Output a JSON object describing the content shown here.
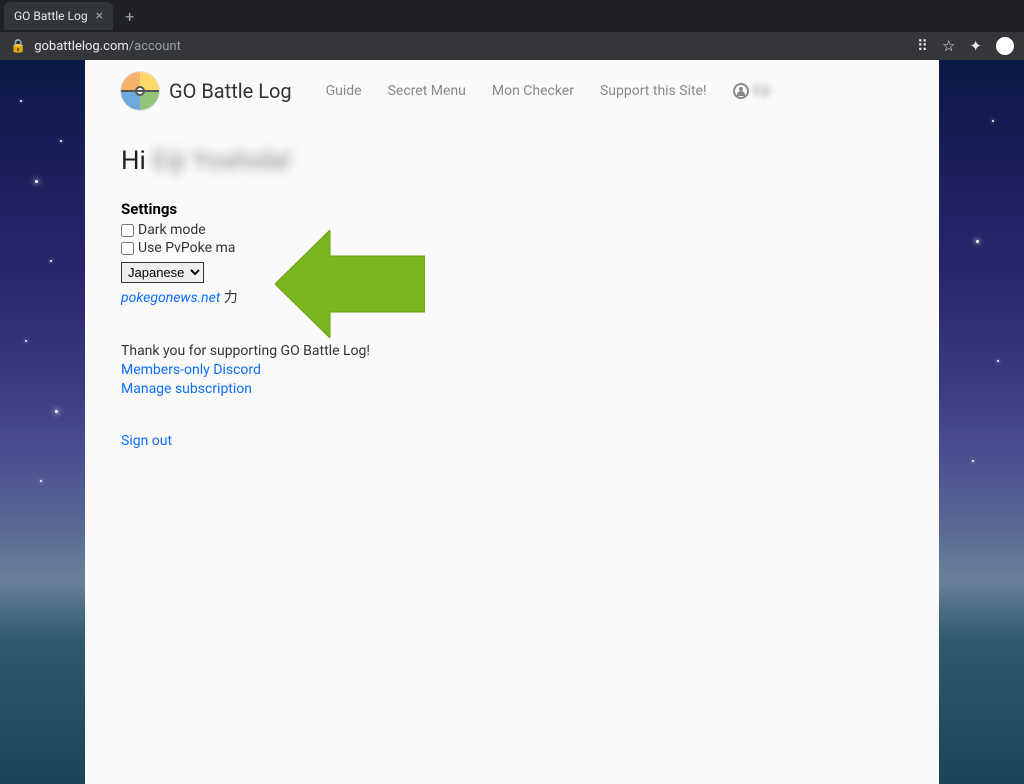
{
  "browser": {
    "tab_title": "GO Battle Log",
    "url_host": "gobattlelog.com",
    "url_path": "/account"
  },
  "nav": {
    "brand": "GO Battle Log",
    "links": [
      "Guide",
      "Secret Menu",
      "Mon Checker",
      "Support this Site!"
    ],
    "username_blurred": "Eiji"
  },
  "main": {
    "greeting_prefix": "Hi ",
    "greeting_name": "Eiji Yoshida!",
    "settings_title": "Settings",
    "dark_mode_label": "Dark mode",
    "dark_mode_checked": false,
    "pvpoke_label": "Use PvPoke ma",
    "pvpoke_checked": false,
    "language_selected": "Japanese",
    "partner_link": "pokegonews.net",
    "partner_trail": " 力",
    "support_text": "Thank you for supporting GO Battle Log!",
    "discord_link": "Members-only Discord",
    "manage_link": "Manage subscription",
    "sign_out": "Sign out"
  },
  "annotation": {
    "arrow_color": "#7ab51d"
  }
}
